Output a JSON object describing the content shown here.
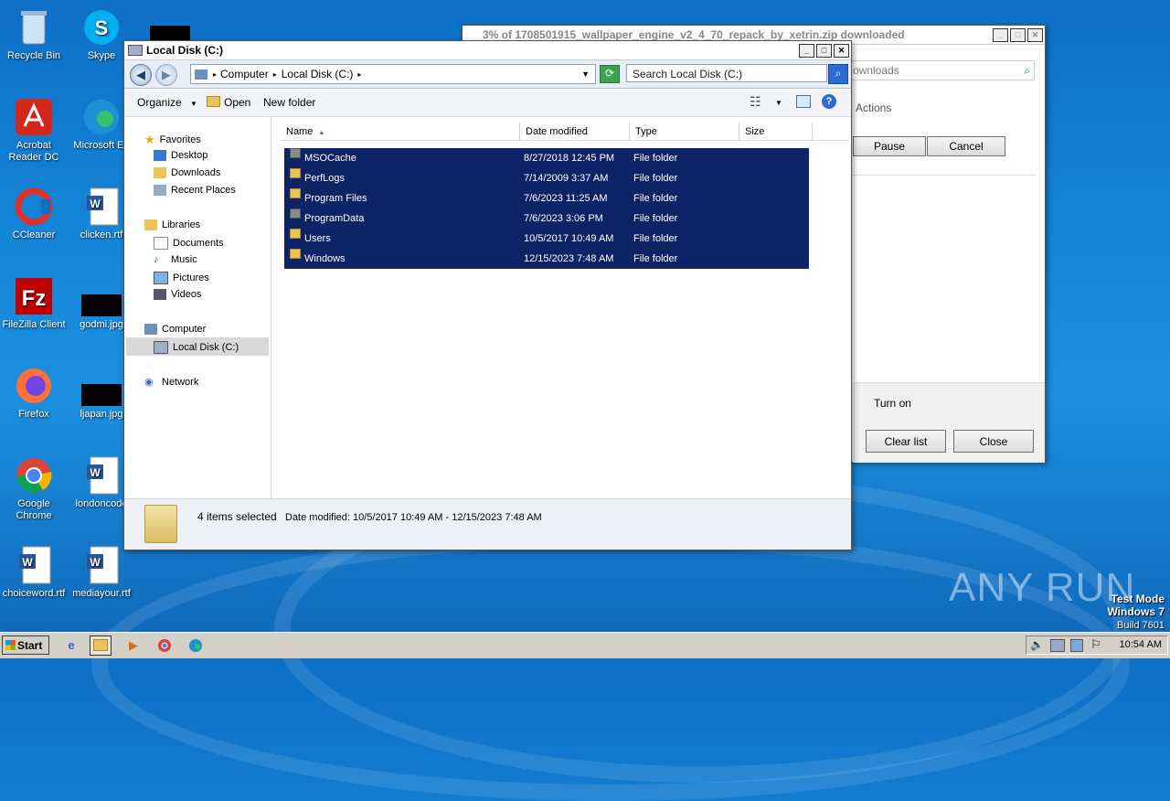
{
  "desktop": {
    "icons": [
      {
        "label": "Recycle Bin"
      },
      {
        "label": "Skype"
      },
      {
        "label": "Acrobat Reader DC"
      },
      {
        "label": "Microsoft Ed"
      },
      {
        "label": "CCleaner"
      },
      {
        "label": "clicken.rtf"
      },
      {
        "label": "FileZilla Client"
      },
      {
        "label": "godmi.jpg"
      },
      {
        "label": "Firefox"
      },
      {
        "label": "ljapan.jpg"
      },
      {
        "label": "Google Chrome"
      },
      {
        "label": "londoncode"
      },
      {
        "label": "choiceword.rtf"
      },
      {
        "label": "mediayour.rtf"
      }
    ]
  },
  "downloads_window": {
    "title": "3% of 1708501915_wallpaper_engine_v2_4_70_repack_by_xetrin.zip downloaded",
    "search_placeholder": "ownloads",
    "actions_label": "Actions",
    "pause_label": "Pause",
    "cancel_label": "Cancel",
    "turn_on_label": "Turn on",
    "clear_list_label": "Clear list",
    "close_label": "Close"
  },
  "explorer": {
    "title": "Local Disk (C:)",
    "breadcrumb": [
      "Computer",
      "Local Disk (C:)"
    ],
    "search_placeholder": "Search Local Disk (C:)",
    "toolbar": {
      "organize": "Organize",
      "open": "Open",
      "new_folder": "New folder"
    },
    "nav": {
      "favorites": "Favorites",
      "desktop": "Desktop",
      "downloads": "Downloads",
      "recent": "Recent Places",
      "libraries": "Libraries",
      "documents": "Documents",
      "music": "Music",
      "pictures": "Pictures",
      "videos": "Videos",
      "computer": "Computer",
      "local_disk": "Local Disk (C:)",
      "network": "Network"
    },
    "columns": {
      "name": "Name",
      "date": "Date modified",
      "type": "Type",
      "size": "Size"
    },
    "files": [
      {
        "name": "MSOCache",
        "date": "8/27/2018 12:45 PM",
        "type": "File folder"
      },
      {
        "name": "PerfLogs",
        "date": "7/14/2009 3:37 AM",
        "type": "File folder"
      },
      {
        "name": "Program Files",
        "date": "7/6/2023 11:25 AM",
        "type": "File folder"
      },
      {
        "name": "ProgramData",
        "date": "7/6/2023 3:06 PM",
        "type": "File folder"
      },
      {
        "name": "Users",
        "date": "10/5/2017 10:49 AM",
        "type": "File folder"
      },
      {
        "name": "Windows",
        "date": "12/15/2023 7:48 AM",
        "type": "File folder"
      }
    ],
    "status": {
      "selected": "4 items selected",
      "date_modified": "Date modified: 10/5/2017 10:49 AM - 12/15/2023 7:48 AM"
    }
  },
  "taskbar": {
    "start_label": "Start",
    "clock": "10:54 AM"
  },
  "watermark": {
    "brand": "ANY RUN",
    "line1": "Test Mode",
    "line2": "Windows 7",
    "line3": "Build 7601"
  }
}
